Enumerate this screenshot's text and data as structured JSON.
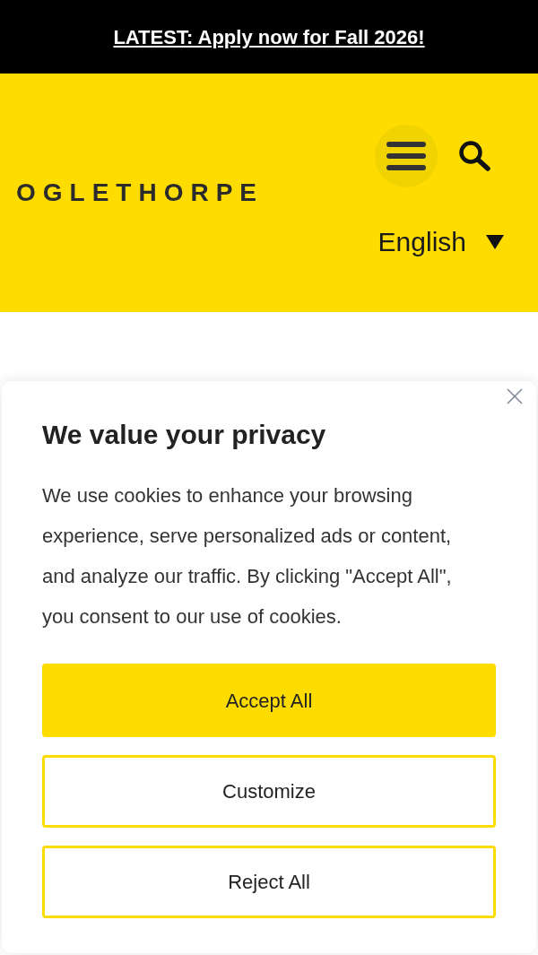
{
  "announcement": {
    "text": "LATEST: Apply now for Fall 2026!"
  },
  "header": {
    "logo": "OGLETHORPE",
    "language": {
      "label": "English"
    }
  },
  "cookie_banner": {
    "title": "We value your privacy",
    "body": "We use cookies to enhance your browsing experience, serve personalized ads or content, and analyze our traffic. By clicking \"Accept All\", you consent to our use of cookies.",
    "buttons": [
      {
        "label": "Accept All",
        "kind": "primary"
      },
      {
        "label": "Customize",
        "kind": "outline"
      },
      {
        "label": "Reject All",
        "kind": "outline"
      }
    ]
  }
}
